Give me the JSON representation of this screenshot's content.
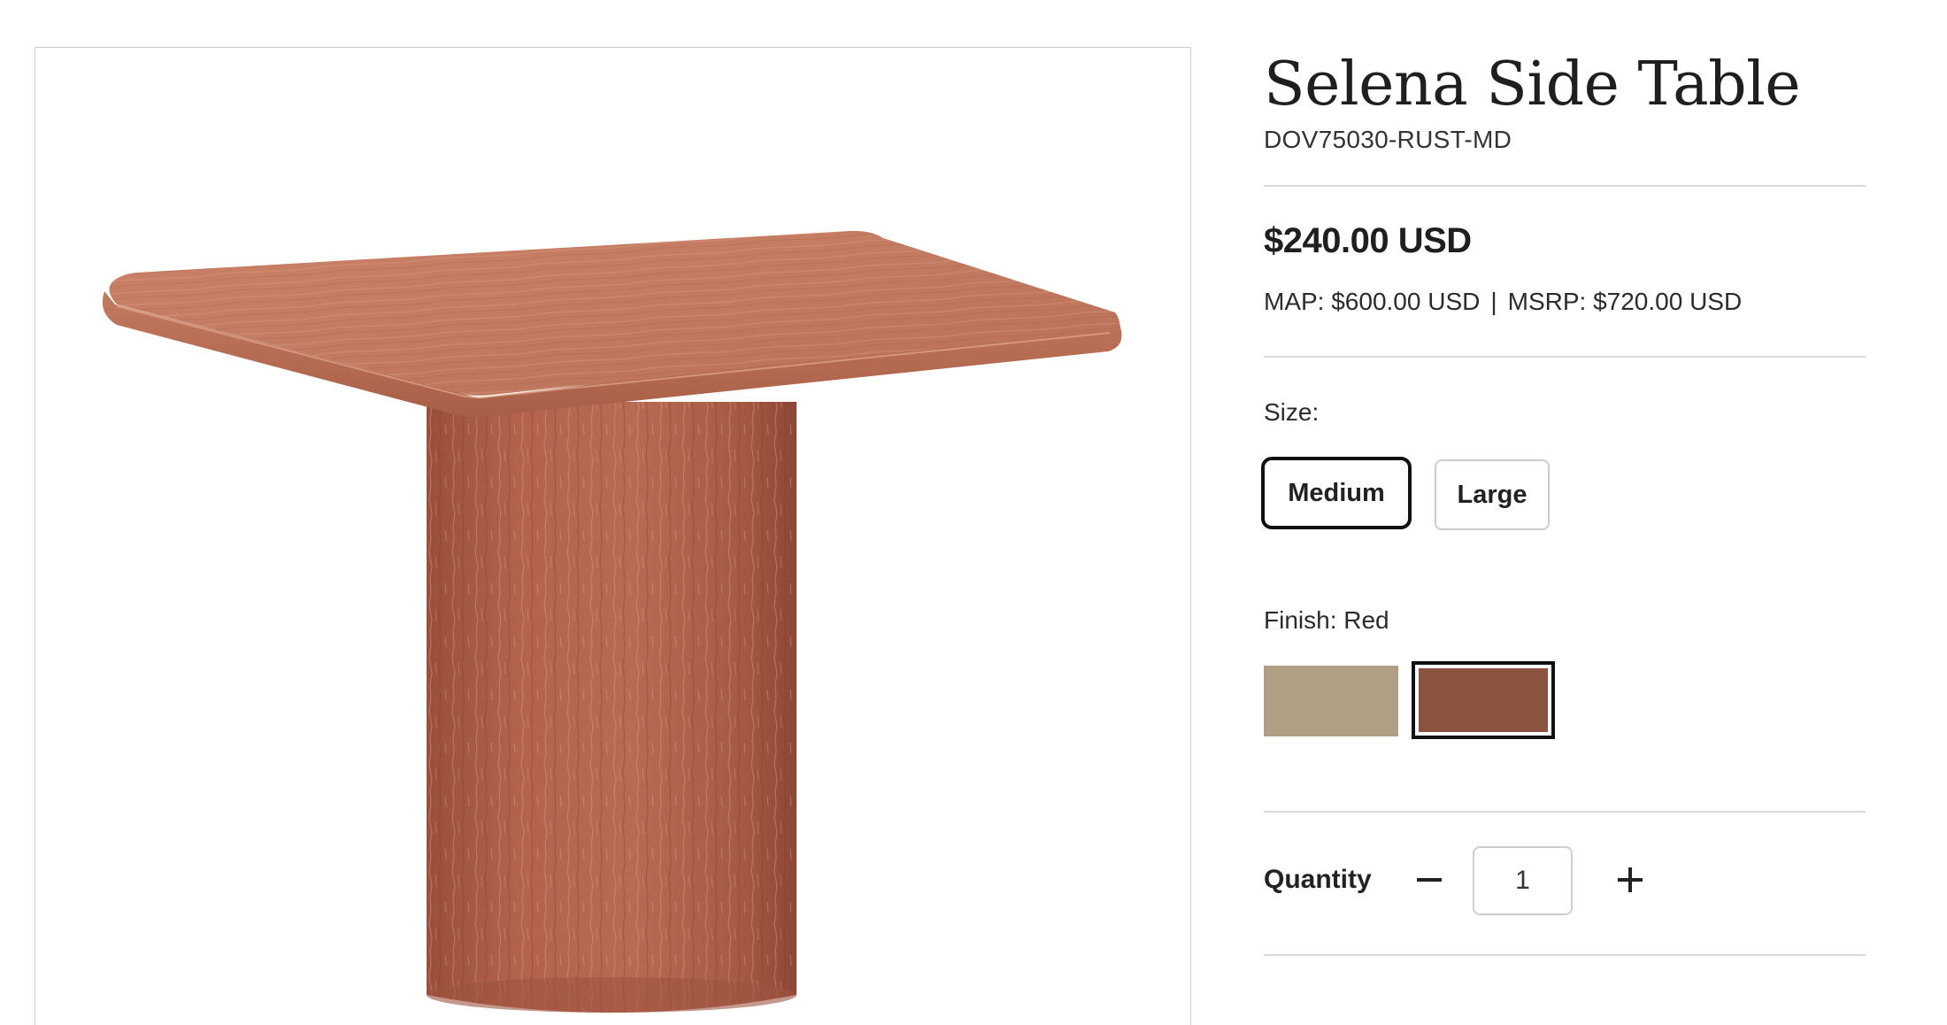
{
  "product": {
    "title": "Selena Side Table",
    "sku": "DOV75030-RUST-MD",
    "image_icon": "product-photo-red-travertine-side-table"
  },
  "pricing": {
    "price": "$240.00 USD",
    "map": "MAP: $600.00 USD",
    "separator": "|",
    "msrp": "MSRP: $720.00 USD"
  },
  "size": {
    "label": "Size:",
    "options": [
      {
        "label": "Medium",
        "selected": true
      },
      {
        "label": "Large",
        "selected": false
      }
    ]
  },
  "finish": {
    "label": "Finish: Red",
    "swatches": [
      {
        "name": "Natural",
        "color": "#b09e85",
        "selected": false
      },
      {
        "name": "Red",
        "color": "#8b5340",
        "selected": true
      }
    ]
  },
  "quantity": {
    "label": "Quantity",
    "value": "1",
    "decrement_icon": "minus-icon",
    "increment_icon": "plus-icon"
  },
  "colors": {
    "divider": "#d9d9d9",
    "selected_border": "#111111",
    "text": "#222222"
  }
}
